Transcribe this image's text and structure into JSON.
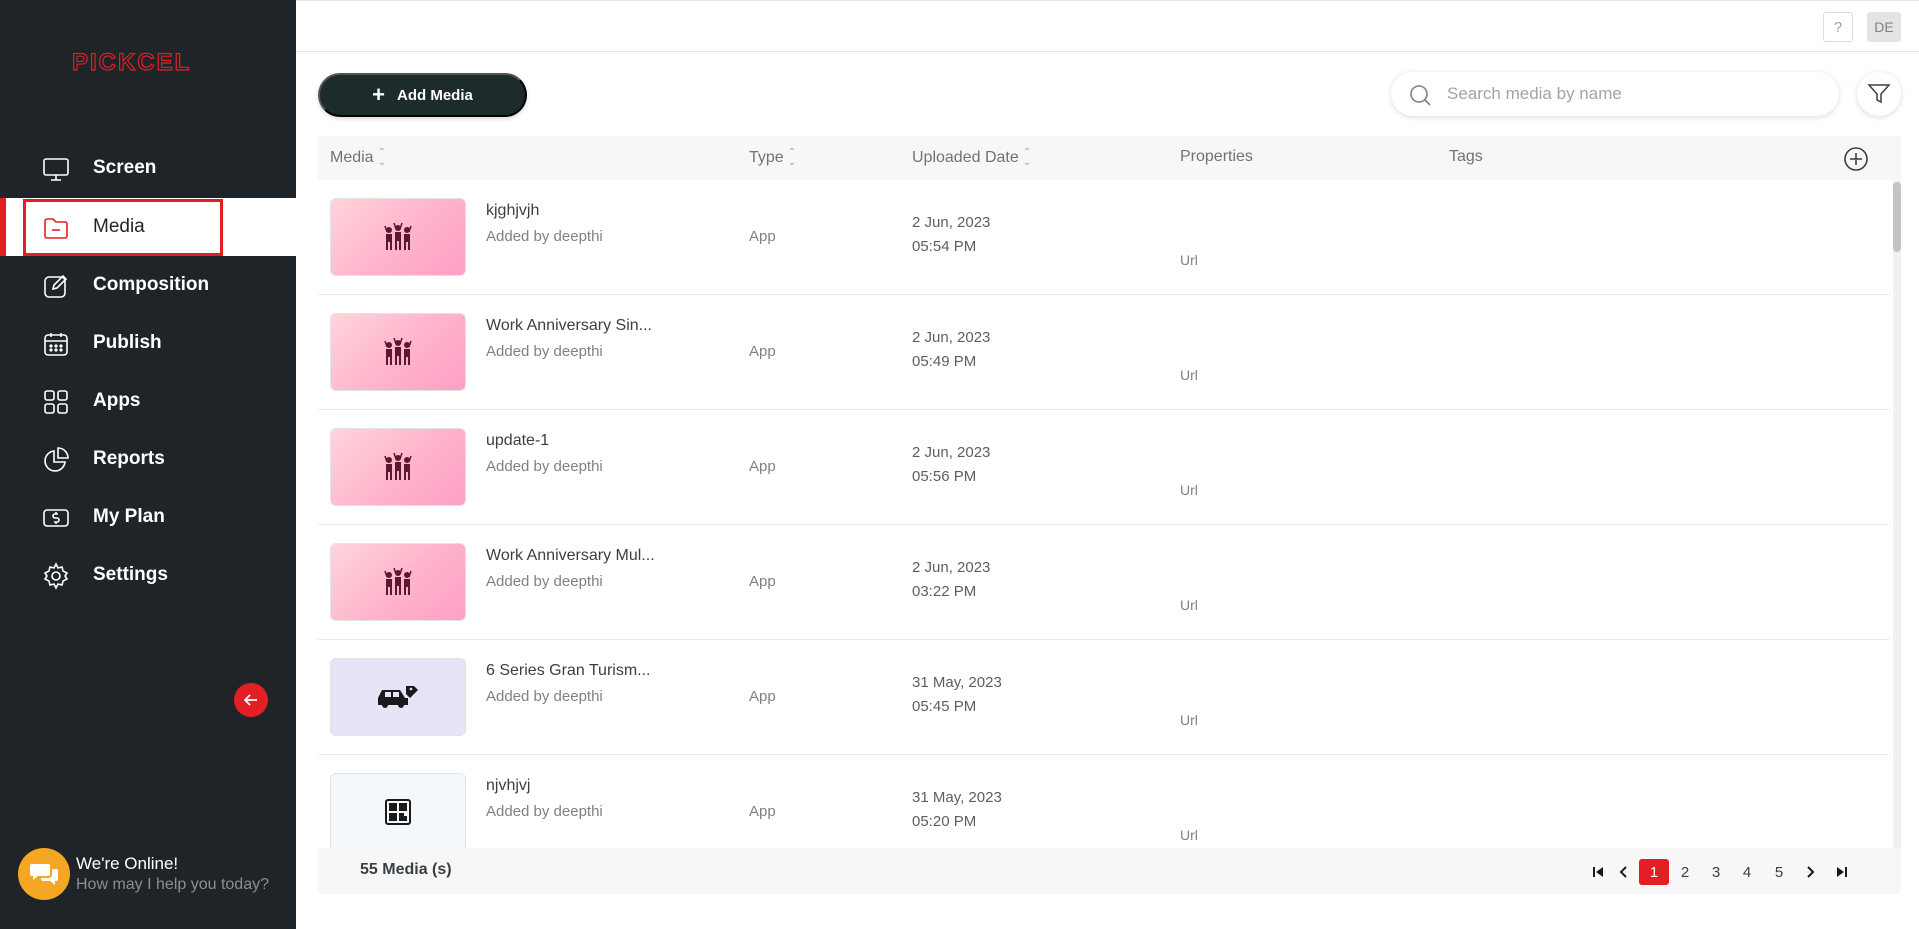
{
  "brand": {
    "logo_text": "PICKCEL",
    "accent": "#e31e24",
    "sidebar_bg": "#1f2428"
  },
  "sidebar": {
    "items": [
      {
        "label": "Screen",
        "icon": "monitor-icon"
      },
      {
        "label": "Media",
        "icon": "folder-icon",
        "active": true
      },
      {
        "label": "Composition",
        "icon": "edit-icon"
      },
      {
        "label": "Publish",
        "icon": "calendar-icon"
      },
      {
        "label": "Apps",
        "icon": "grid-icon"
      },
      {
        "label": "Reports",
        "icon": "pie-chart-icon"
      },
      {
        "label": "My Plan",
        "icon": "dollar-icon"
      },
      {
        "label": "Settings",
        "icon": "gear-icon"
      }
    ],
    "collapse_icon": "arrow-left-icon"
  },
  "chat": {
    "title": "We're Online!",
    "subtitle": "How may I help you today?",
    "icon": "chat-icon"
  },
  "topbar": {
    "help_label": "?",
    "avatar_initials": "DE"
  },
  "toolbar": {
    "add_label": "Add Media",
    "search_placeholder": "Search media by name",
    "filter_icon": "filter-icon"
  },
  "table": {
    "columns": [
      "Media",
      "Type",
      "Uploaded Date",
      "Properties",
      "Tags"
    ],
    "rows": [
      {
        "name": "kjghjvjh",
        "added_by": "Added by deepthi",
        "type": "App",
        "date": "2 Jun, 2023",
        "time": "05:54 PM",
        "properties": "Url",
        "thumb": "people-icon"
      },
      {
        "name": "Work Anniversary Sin...",
        "added_by": "Added by deepthi",
        "type": "App",
        "date": "2 Jun, 2023",
        "time": "05:49 PM",
        "properties": "Url",
        "thumb": "people-icon"
      },
      {
        "name": "update-1",
        "added_by": "Added by deepthi",
        "type": "App",
        "date": "2 Jun, 2023",
        "time": "05:56 PM",
        "properties": "Url",
        "thumb": "people-icon"
      },
      {
        "name": "Work Anniversary Mul...",
        "added_by": "Added by deepthi",
        "type": "App",
        "date": "2 Jun, 2023",
        "time": "03:22 PM",
        "properties": "Url",
        "thumb": "people-icon"
      },
      {
        "name": "6 Series Gran Turism...",
        "added_by": "Added by deepthi",
        "type": "App",
        "date": "31 May, 2023",
        "time": "05:45 PM",
        "properties": "Url",
        "thumb": "car-tag-icon"
      },
      {
        "name": "njvhjvj",
        "added_by": "Added by deepthi",
        "type": "App",
        "date": "31 May, 2023",
        "time": "05:20 PM",
        "properties": "Url",
        "thumb": "qr-code-icon"
      }
    ]
  },
  "footer": {
    "count_label": "55 Media (s)",
    "pages": [
      "1",
      "2",
      "3",
      "4",
      "5"
    ],
    "current_page": "1"
  }
}
